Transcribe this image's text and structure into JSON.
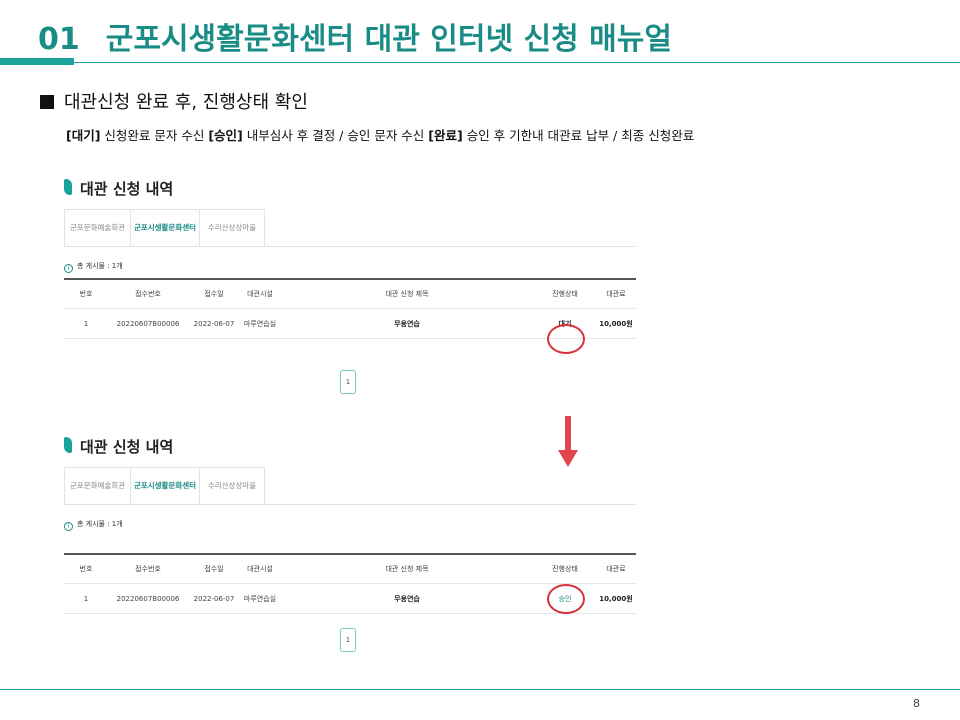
{
  "header": {
    "number": "01",
    "title": "군포시생활문화센터 대관 인터넷 신청 매뉴얼"
  },
  "section": {
    "heading": "대관신청 완료 후, 진행상태 확인",
    "status_desc": [
      {
        "label": "[대기]",
        "text": " 신청완료 문자 수신 "
      },
      {
        "label": "[승인]",
        "text": " 내부심사 후 결정 / 승인 문자 수신  "
      },
      {
        "label": "[완료]",
        "text": " 승인 후 기한내 대관료 납부 / 최종 신청완료"
      }
    ]
  },
  "panels": [
    {
      "title": "대관 신청 내역",
      "tabs": [
        "군포문화예술회관",
        "군포시생활문화센터",
        "수리산상상마을"
      ],
      "active_tab": 1,
      "total_label": "총 게시물 : 1개",
      "columns": [
        "번호",
        "접수번호",
        "접수일",
        "대관시설",
        "대관 신청 제목",
        "진행상태",
        "대관료"
      ],
      "row": {
        "no": "1",
        "receipt_no": "20220607B00006",
        "date": "2022-06-07",
        "facility": "마루연습실",
        "subject": "무용연습",
        "status": "대기",
        "fee": "10,000원"
      },
      "page": "1"
    },
    {
      "title": "대관 신청 내역",
      "tabs": [
        "군포문화예술회관",
        "군포시생활문화센터",
        "수리산상상마을"
      ],
      "active_tab": 1,
      "total_label": "총 게시물 : 1개",
      "columns": [
        "번호",
        "접수번호",
        "접수일",
        "대관시설",
        "대관 신청 제목",
        "진행상태",
        "대관료"
      ],
      "row": {
        "no": "1",
        "receipt_no": "20220607B00006",
        "date": "2022-06-07",
        "facility": "마루연습실",
        "subject": "무용연습",
        "status": "승인",
        "fee": "10,000원"
      },
      "page": "1"
    }
  ],
  "colors": {
    "accent": "#1aa39a",
    "title": "#1a8c86",
    "highlight": "#d8333a",
    "arrow": "#e0474c"
  },
  "icons": {
    "arrow": "down-arrow-icon",
    "info": "info-icon"
  },
  "footer": {
    "page_number": "8"
  }
}
